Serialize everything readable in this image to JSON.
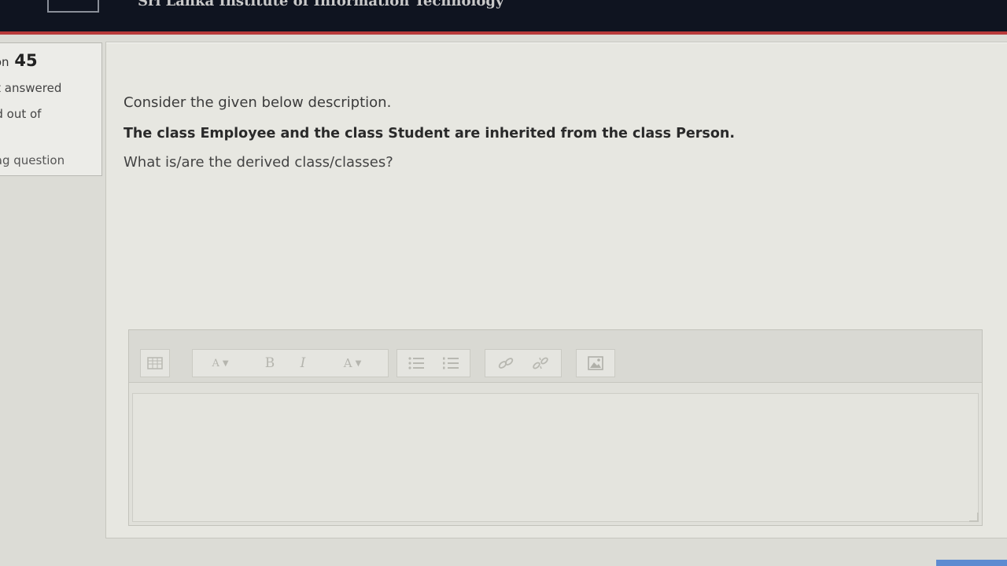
{
  "header": {
    "site_title": "Sri Lanka Institute of Information Technology"
  },
  "info": {
    "question_label": "stion",
    "question_number": "45",
    "status": "yet answered",
    "marked": "ked out of",
    "flag": "Flag question"
  },
  "question": {
    "line1": "Consider the given below description.",
    "line2": "The class Employee and the class Student are inherited from the class Person.",
    "line3": "What is/are the derived class/classes?"
  },
  "toolbar": {
    "toggle_icon": "toolbar-toggle-icon",
    "font_size": "A",
    "bold": "B",
    "italic": "I",
    "font_color": "A",
    "unordered_list_icon": "unordered-list-icon",
    "ordered_list_icon": "ordered-list-icon",
    "link_icon": "link-icon",
    "unlink_icon": "unlink-icon",
    "image_icon": "image-icon"
  },
  "answer": {
    "value": ""
  },
  "colors": {
    "header_bg": "#0f1420",
    "header_accent": "#b83a3a",
    "page_bg": "#dcdcd6",
    "panel_bg": "#e7e7e1"
  }
}
